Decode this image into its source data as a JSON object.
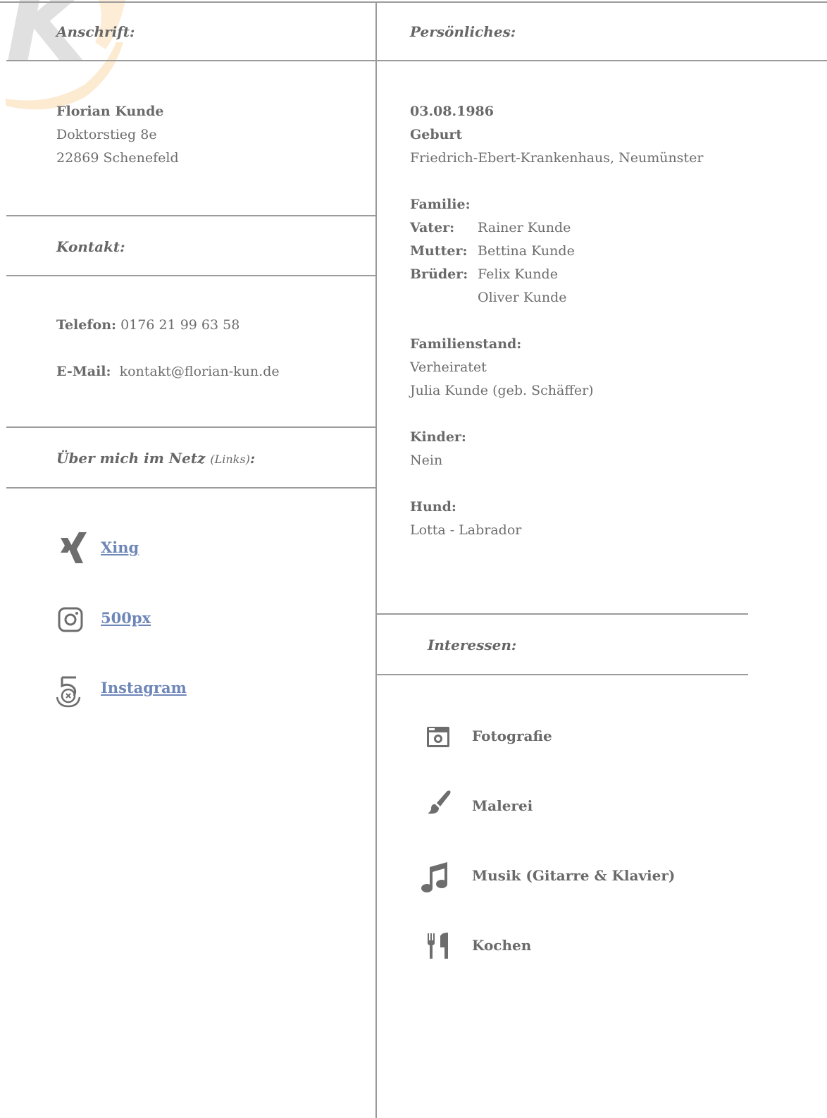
{
  "colors": {
    "text": "#6d6d6d",
    "line": "#9b9b9b",
    "link": "#6f87b8",
    "logo_accent": "#f6b35a"
  },
  "logo": {
    "letter": "K"
  },
  "sections": {
    "anschrift": {
      "title": "Anschrift:"
    },
    "kontakt": {
      "title": "Kontakt:"
    },
    "netz": {
      "title": "Über mich im Netz",
      "title_small": "(Links)",
      "title_suffix": ":"
    },
    "persoenliches": {
      "title": "Persönliches:"
    },
    "interessen": {
      "title": "Interessen:"
    }
  },
  "address": {
    "name": "Florian Kunde",
    "street": "Doktorstieg 8e",
    "city": "22869 Schenefeld"
  },
  "contact": {
    "phone_label": "Telefon:",
    "phone": "0176 21 99 63 58",
    "email_label": "E-Mail:",
    "email": "kontakt@florian-kun.de"
  },
  "links": [
    {
      "label": "Xing",
      "icon": "xing-icon"
    },
    {
      "label": "500px",
      "icon": "instagram-icon"
    },
    {
      "label": "Instagram",
      "icon": "500px-icon"
    }
  ],
  "personal": {
    "birth_date": "03.08.1986",
    "birth_label": "Geburt",
    "birth_place": "Friedrich-Ebert-Krankenhaus, Neumünster",
    "family_label": "Familie:",
    "father_label": "Vater:",
    "father": "Rainer Kunde",
    "mother_label": "Mutter:",
    "mother": "Bettina Kunde",
    "brothers_label": "Brüder:",
    "brother_1": "Felix Kunde",
    "brother_2": "Oliver Kunde",
    "marital_label": "Familienstand:",
    "marital": "Verheiratet",
    "spouse": "Julia Kunde (geb. Schäffer)",
    "children_label": "Kinder:",
    "children": "Nein",
    "dog_label": "Hund:",
    "dog": "Lotta - Labrador"
  },
  "interests": [
    {
      "label": "Fotografie",
      "icon": "camera-icon"
    },
    {
      "label": "Malerei",
      "icon": "paintbrush-icon"
    },
    {
      "label": "Musik (Gitarre & Klavier)",
      "icon": "music-note-icon"
    },
    {
      "label": "Kochen",
      "icon": "cutlery-icon"
    }
  ]
}
